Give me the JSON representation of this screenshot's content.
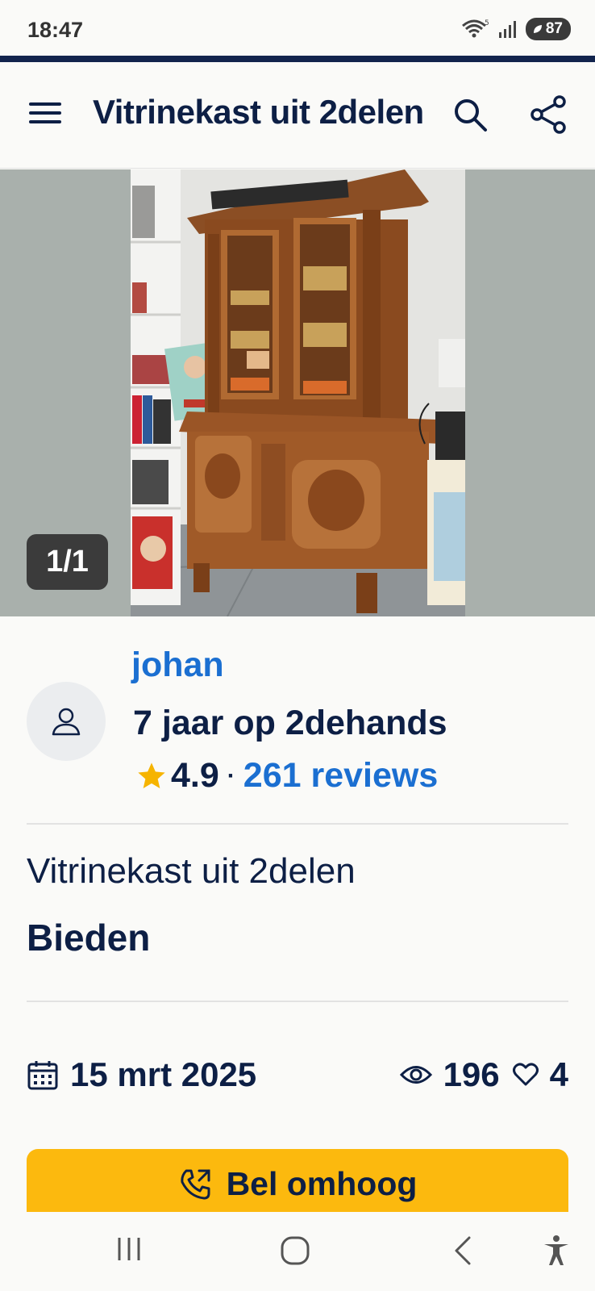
{
  "status_bar": {
    "time": "18:47",
    "wifi_icon": "wifi-5g-icon",
    "signal_icon": "cell-signal-icon",
    "battery_level": "87"
  },
  "header": {
    "title": "Vitrinekast uit 2delen",
    "menu_icon": "hamburger-menu-icon",
    "search_icon": "search-icon",
    "share_icon": "share-icon"
  },
  "gallery": {
    "counter": "1/1"
  },
  "seller": {
    "name": "johan",
    "years": "7 jaar op 2dehands",
    "rating": "4.9",
    "separator": "·",
    "reviews": "261 reviews",
    "avatar_icon": "user-icon"
  },
  "listing": {
    "title": "Vitrinekast uit 2delen",
    "price": "Bieden",
    "date": "15 mrt 2025",
    "views": "196",
    "favorites": "4"
  },
  "cta": {
    "label": "Bel omhoog",
    "icon": "phone-call-icon"
  },
  "system_nav": {
    "recents_icon": "recents-icon",
    "home_icon": "home-icon",
    "back_icon": "back-icon",
    "accessibility_icon": "accessibility-icon"
  },
  "colors": {
    "brand_navy": "#0d1f45",
    "link_blue": "#1b6fd1",
    "cta_yellow": "#fcb90e",
    "star_yellow": "#f6b400"
  }
}
